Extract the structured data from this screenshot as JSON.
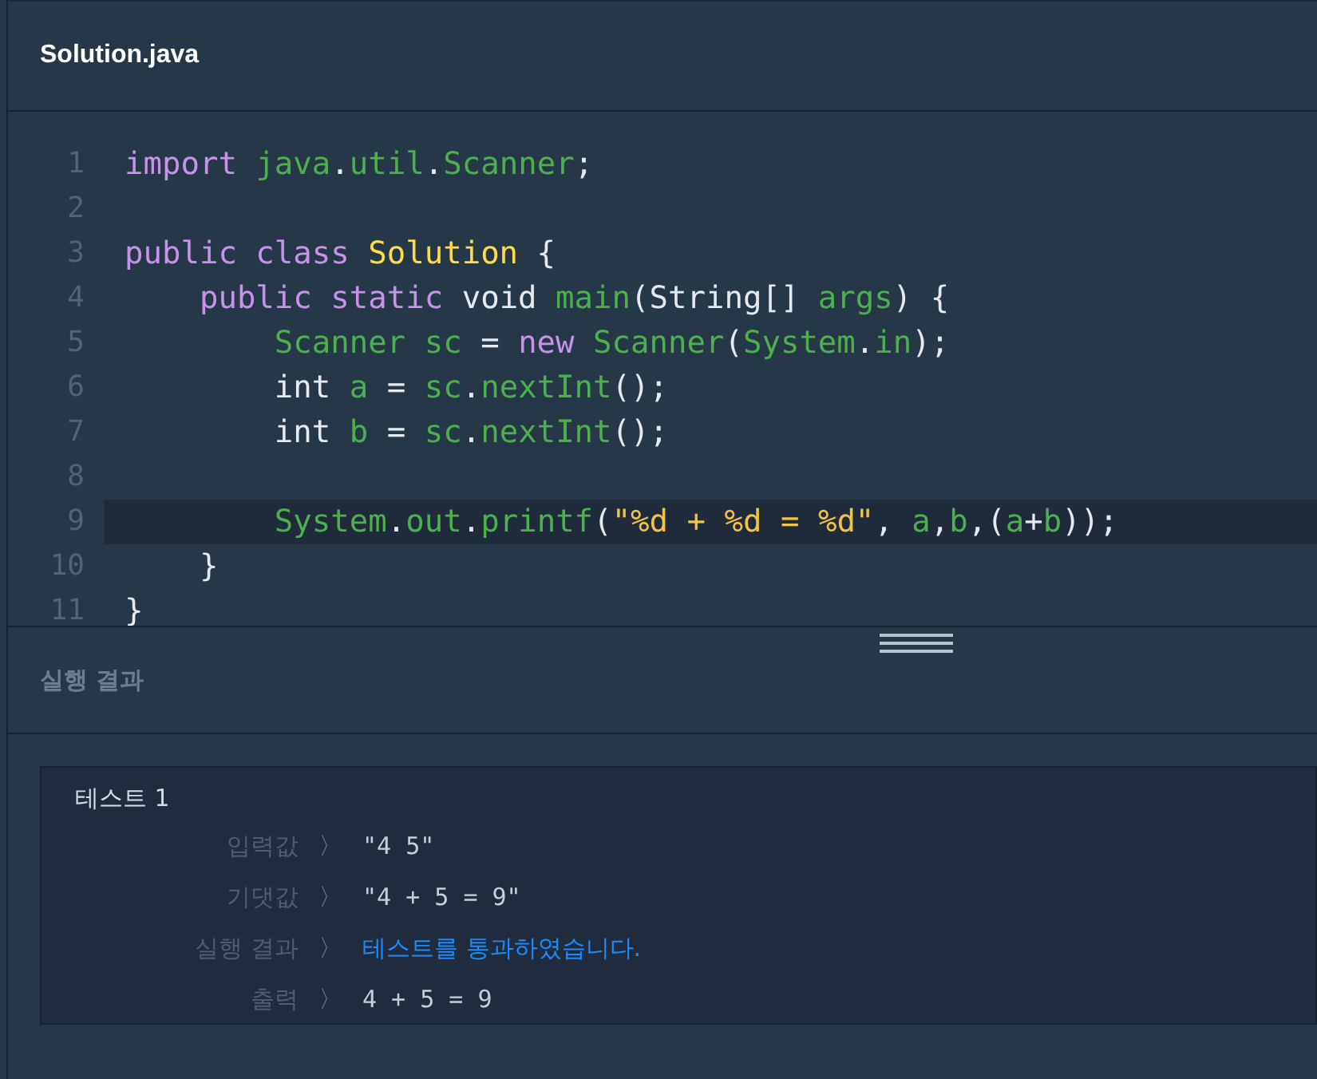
{
  "editor": {
    "filename": "Solution.java",
    "lines": [
      {
        "number": "1",
        "highlighted": false,
        "tokens": [
          {
            "kind": "keyword",
            "text": "import"
          },
          {
            "kind": "ident",
            "text": " java"
          },
          {
            "kind": "plain",
            "text": "."
          },
          {
            "kind": "ident",
            "text": "util"
          },
          {
            "kind": "plain",
            "text": "."
          },
          {
            "kind": "ident",
            "text": "Scanner"
          },
          {
            "kind": "plain",
            "text": ";"
          }
        ]
      },
      {
        "number": "2",
        "highlighted": false
      },
      {
        "number": "3",
        "highlighted": false,
        "tokens": [
          {
            "kind": "keyword",
            "text": "public class"
          },
          {
            "kind": "classname",
            "text": " Solution"
          },
          {
            "kind": "plain",
            "text": " {"
          }
        ]
      },
      {
        "number": "4",
        "highlighted": false,
        "tokens": [
          {
            "kind": "keyword",
            "text": "    public static"
          },
          {
            "kind": "plain",
            "text": " void "
          },
          {
            "kind": "ident",
            "text": "main"
          },
          {
            "kind": "plain",
            "text": "(String[] "
          },
          {
            "kind": "ident",
            "text": "args"
          },
          {
            "kind": "plain",
            "text": ") {"
          }
        ]
      },
      {
        "number": "5",
        "highlighted": false,
        "tokens": [
          {
            "kind": "ident",
            "text": "        Scanner sc"
          },
          {
            "kind": "plain",
            "text": " = "
          },
          {
            "kind": "keyword",
            "text": "new"
          },
          {
            "kind": "ident",
            "text": " Scanner"
          },
          {
            "kind": "plain",
            "text": "("
          },
          {
            "kind": "ident",
            "text": "System"
          },
          {
            "kind": "plain",
            "text": "."
          },
          {
            "kind": "ident",
            "text": "in"
          },
          {
            "kind": "plain",
            "text": ");"
          }
        ]
      },
      {
        "number": "6",
        "highlighted": false,
        "tokens": [
          {
            "kind": "plain",
            "text": "        int "
          },
          {
            "kind": "ident",
            "text": "a"
          },
          {
            "kind": "plain",
            "text": " = "
          },
          {
            "kind": "ident",
            "text": "sc"
          },
          {
            "kind": "plain",
            "text": "."
          },
          {
            "kind": "ident",
            "text": "nextInt"
          },
          {
            "kind": "plain",
            "text": "();"
          }
        ]
      },
      {
        "number": "7",
        "highlighted": false,
        "tokens": [
          {
            "kind": "plain",
            "text": "        int "
          },
          {
            "kind": "ident",
            "text": "b"
          },
          {
            "kind": "plain",
            "text": " = "
          },
          {
            "kind": "ident",
            "text": "sc"
          },
          {
            "kind": "plain",
            "text": "."
          },
          {
            "kind": "ident",
            "text": "nextInt"
          },
          {
            "kind": "plain",
            "text": "();"
          }
        ]
      },
      {
        "number": "8",
        "highlighted": false
      },
      {
        "number": "9",
        "highlighted": true,
        "tokens": [
          {
            "kind": "ident",
            "text": "        System"
          },
          {
            "kind": "plain",
            "text": "."
          },
          {
            "kind": "ident",
            "text": "out"
          },
          {
            "kind": "plain",
            "text": "."
          },
          {
            "kind": "ident",
            "text": "printf"
          },
          {
            "kind": "plain",
            "text": "("
          },
          {
            "kind": "string",
            "text": "\"%d + %d = %d\""
          },
          {
            "kind": "plain",
            "text": ", "
          },
          {
            "kind": "ident",
            "text": "a"
          },
          {
            "kind": "plain",
            "text": ","
          },
          {
            "kind": "ident",
            "text": "b"
          },
          {
            "kind": "plain",
            "text": ",("
          },
          {
            "kind": "ident",
            "text": "a"
          },
          {
            "kind": "plain",
            "text": "+"
          },
          {
            "kind": "ident",
            "text": "b"
          },
          {
            "kind": "plain",
            "text": "));"
          }
        ]
      },
      {
        "number": "10",
        "highlighted": false,
        "tokens": [
          {
            "kind": "plain",
            "text": "    }"
          }
        ]
      },
      {
        "number": "11",
        "highlighted": false,
        "tokens": [
          {
            "kind": "plain",
            "text": "}"
          }
        ]
      }
    ]
  },
  "results": {
    "title": "실행 결과",
    "tests": [
      {
        "name": "테스트 1",
        "rows": [
          {
            "label": "입력값",
            "separator": "〉",
            "value": "\"4 5\"",
            "kind": "plain"
          },
          {
            "label": "기댓값",
            "separator": "〉",
            "value": "\"4 + 5 = 9\"",
            "kind": "plain"
          },
          {
            "label": "실행 결과",
            "separator": "〉",
            "value": "테스트를 통과하였습니다.",
            "kind": "status"
          },
          {
            "label": "출력",
            "separator": "〉",
            "value": "4 + 5 = 9",
            "kind": "plain"
          }
        ]
      }
    ]
  }
}
